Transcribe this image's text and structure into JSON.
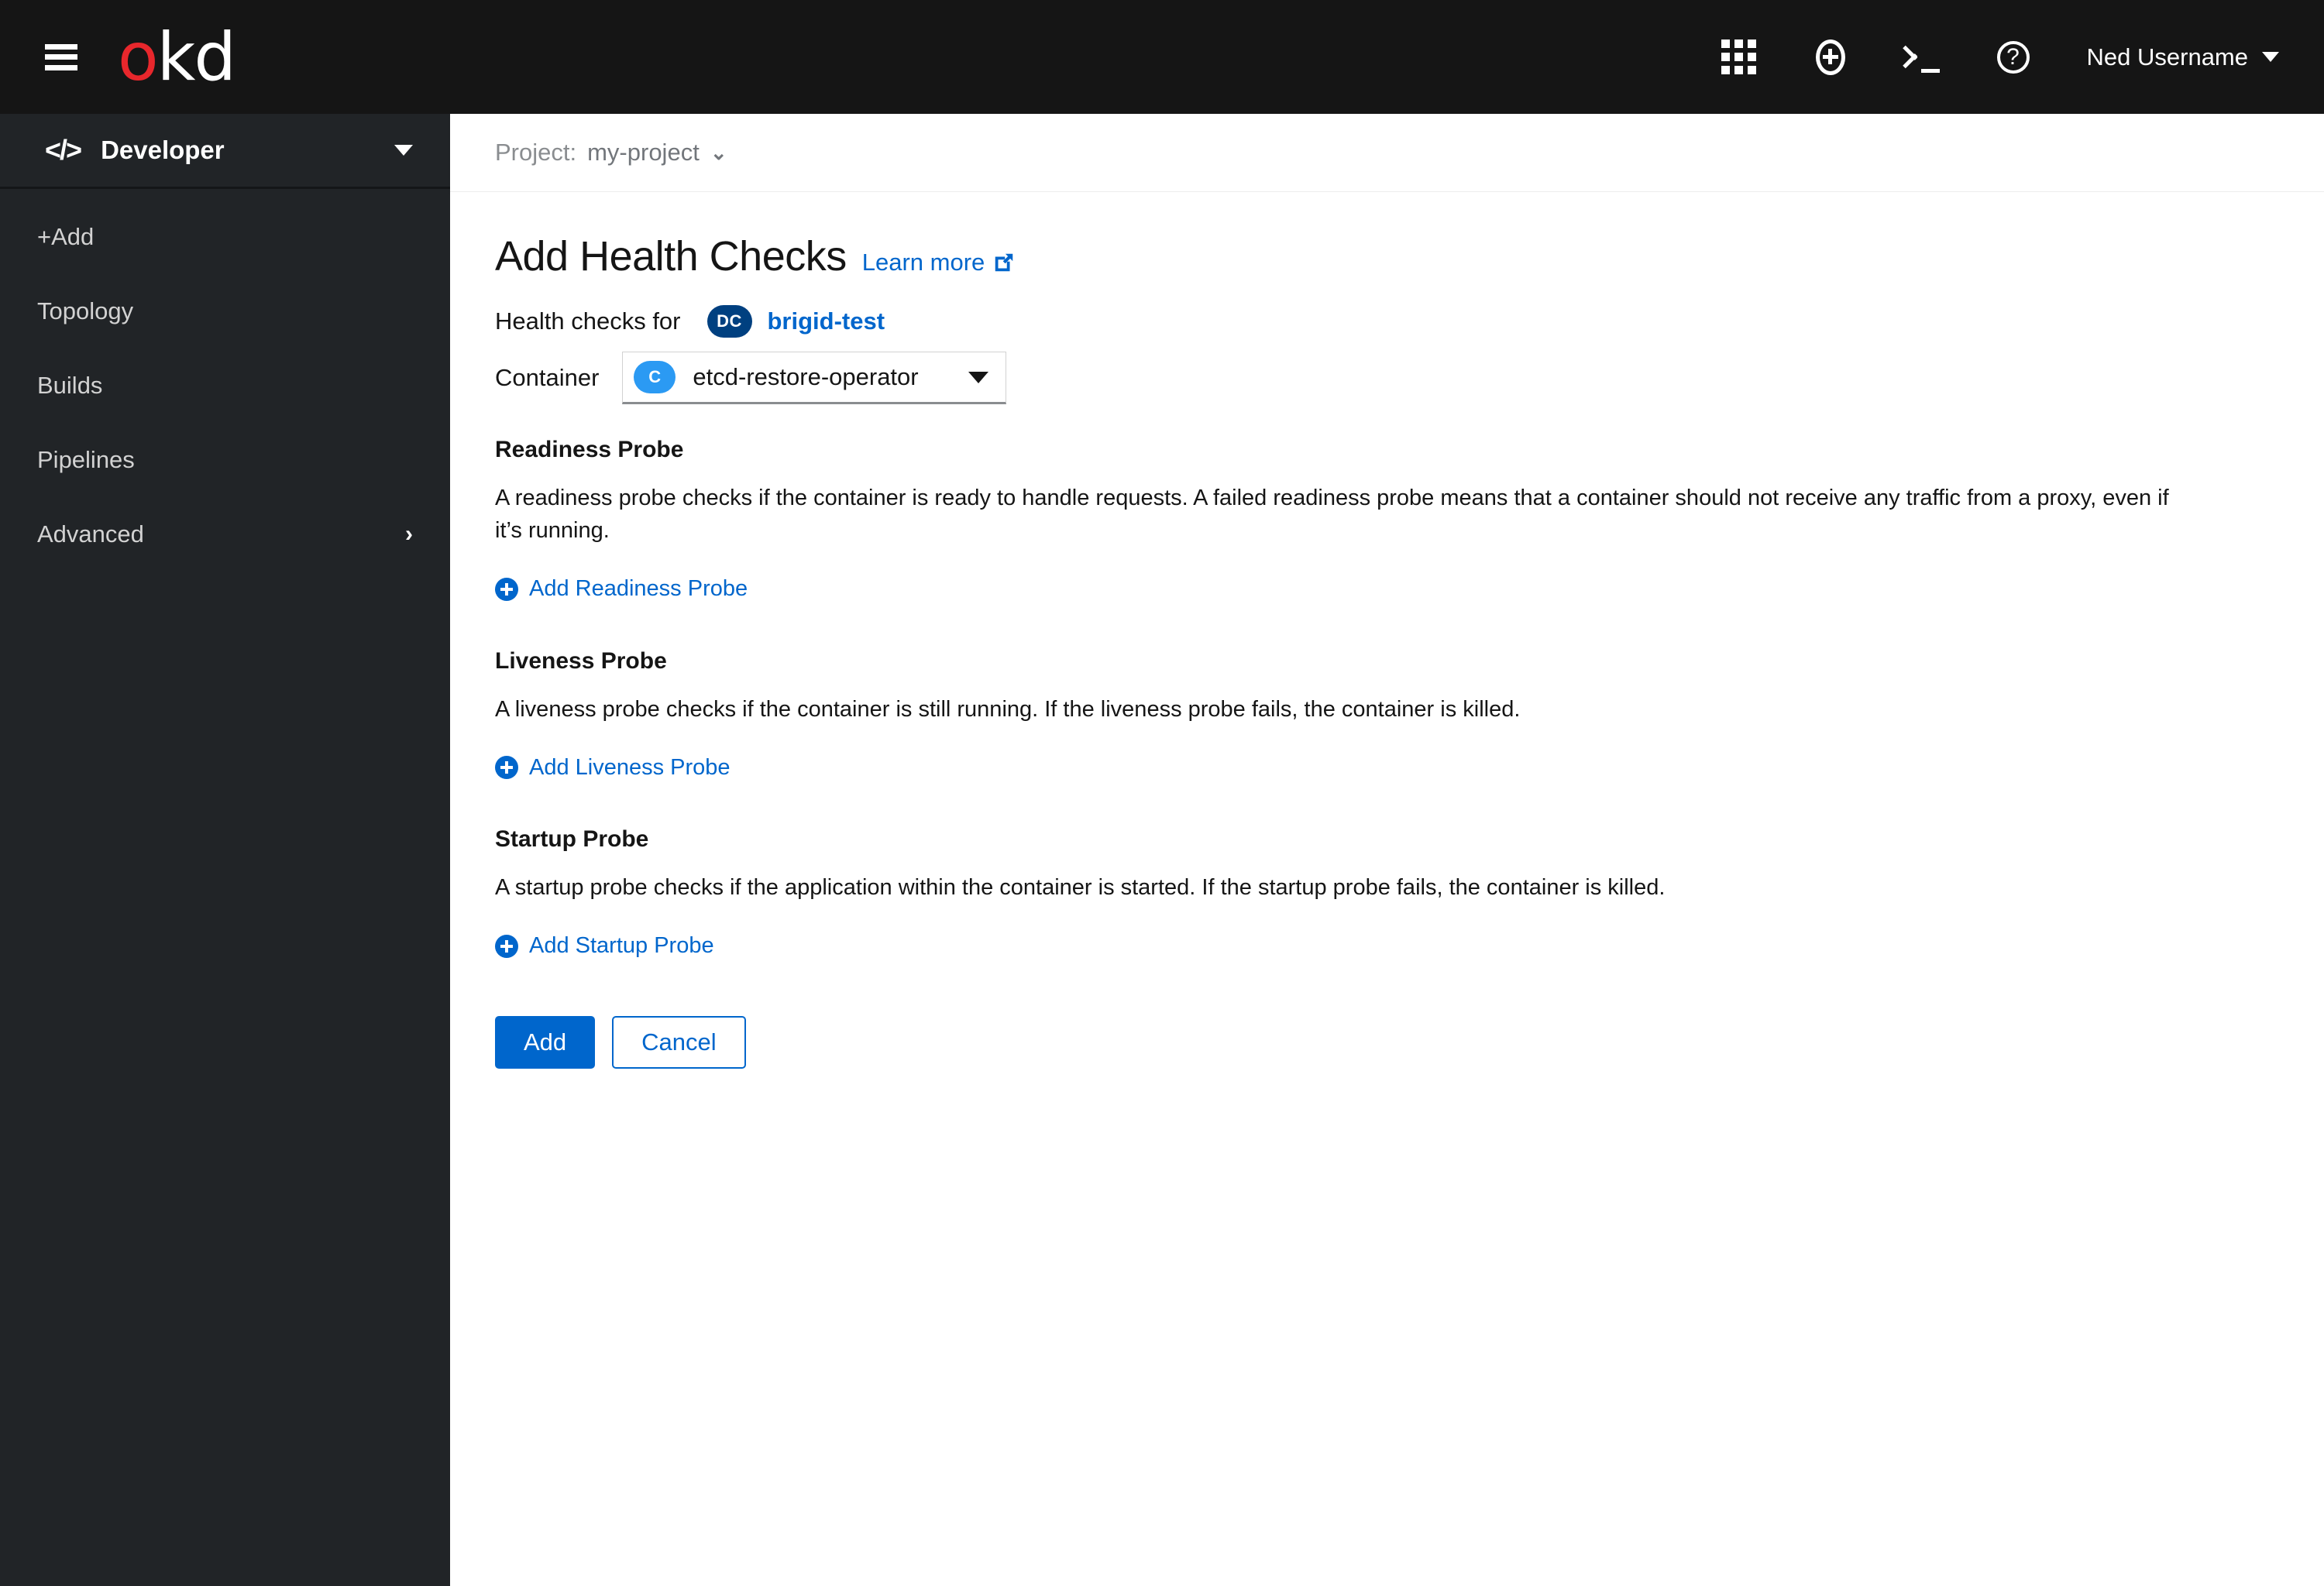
{
  "masthead": {
    "menu_icon": "hamburger-icon",
    "brand": {
      "part_red": "o",
      "part_white": "kd",
      "full": "okd"
    },
    "icons": [
      {
        "name": "applications-grid-icon",
        "label": "Applications"
      },
      {
        "name": "plus-circle-icon",
        "label": "Add"
      },
      {
        "name": "terminal-icon",
        "label": "Command line terminal"
      },
      {
        "name": "help-icon",
        "label": "?"
      }
    ],
    "user": {
      "name": "Ned Username"
    }
  },
  "sidebar": {
    "perspective": {
      "label": "Developer",
      "icon": "code-icon",
      "caret": "chevron-down-icon"
    },
    "items": [
      {
        "label": "+Add",
        "has_chevron": false
      },
      {
        "label": "Topology",
        "has_chevron": false
      },
      {
        "label": "Builds",
        "has_chevron": false
      },
      {
        "label": "Pipelines",
        "has_chevron": false
      },
      {
        "label": "Advanced",
        "has_chevron": true,
        "chevron": "›"
      }
    ]
  },
  "project_bar": {
    "label": "Project:",
    "value": "my-project",
    "chevron": "⌄"
  },
  "page": {
    "title": "Add Health Checks",
    "learn_more": "Learn more",
    "health_checks_for_label": "Health checks for",
    "resource_badge": "DC",
    "resource_name": "brigid-test",
    "container_label": "Container",
    "container_badge": "C",
    "container_value": "etcd-restore-operator"
  },
  "probes": [
    {
      "title": "Readiness Probe",
      "description": "A readiness probe checks if the container is ready to handle requests. A failed readiness probe means that a container should not receive any traffic from a proxy, even if it’s running.",
      "add_label": "Add Readiness Probe"
    },
    {
      "title": "Liveness Probe",
      "description": "A liveness probe checks if the container is still running. If the liveness probe fails, the container is killed.",
      "add_label": "Add Liveness Probe"
    },
    {
      "title": "Startup Probe",
      "description": "A startup probe checks if the application within the container is started. If the startup probe fails, the container is killed.",
      "add_label": "Add Startup Probe"
    }
  ],
  "actions": {
    "submit_label": "Add",
    "cancel_label": "Cancel"
  },
  "colors": {
    "masthead_bg": "#151515",
    "sidebar_bg": "#212427",
    "brand_red": "#e8272c",
    "link_blue": "#0066cc",
    "primary_button": "#0066cc",
    "badge_dc": "#004080",
    "badge_c": "#2b9af3",
    "muted_text": "#72767b"
  }
}
